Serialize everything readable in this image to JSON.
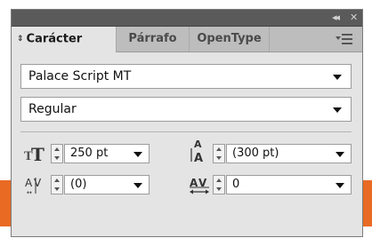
{
  "window": {
    "collapse_glyph": "◂◂",
    "close_glyph": "✕"
  },
  "tabs": [
    {
      "label": "Carácter",
      "active": true,
      "icon": "updown-arrows-icon"
    },
    {
      "label": "Párrafo",
      "active": false
    },
    {
      "label": "OpenType",
      "active": false
    }
  ],
  "font_family": {
    "value": "Palace Script MT"
  },
  "font_style": {
    "value": "Regular"
  },
  "font_size": {
    "value": "250 pt",
    "icon": "font-size-icon"
  },
  "leading": {
    "value": "(300 pt)",
    "icon": "leading-icon"
  },
  "kerning": {
    "value": "(0)",
    "icon": "kerning-icon"
  },
  "tracking": {
    "value": "0",
    "icon": "tracking-icon"
  },
  "colors": {
    "panel_bg": "#e4e4e4",
    "titlebar": "#5a5a5a",
    "tabbar": "#bdbdbd",
    "canvas_accent": "#e86a23"
  }
}
